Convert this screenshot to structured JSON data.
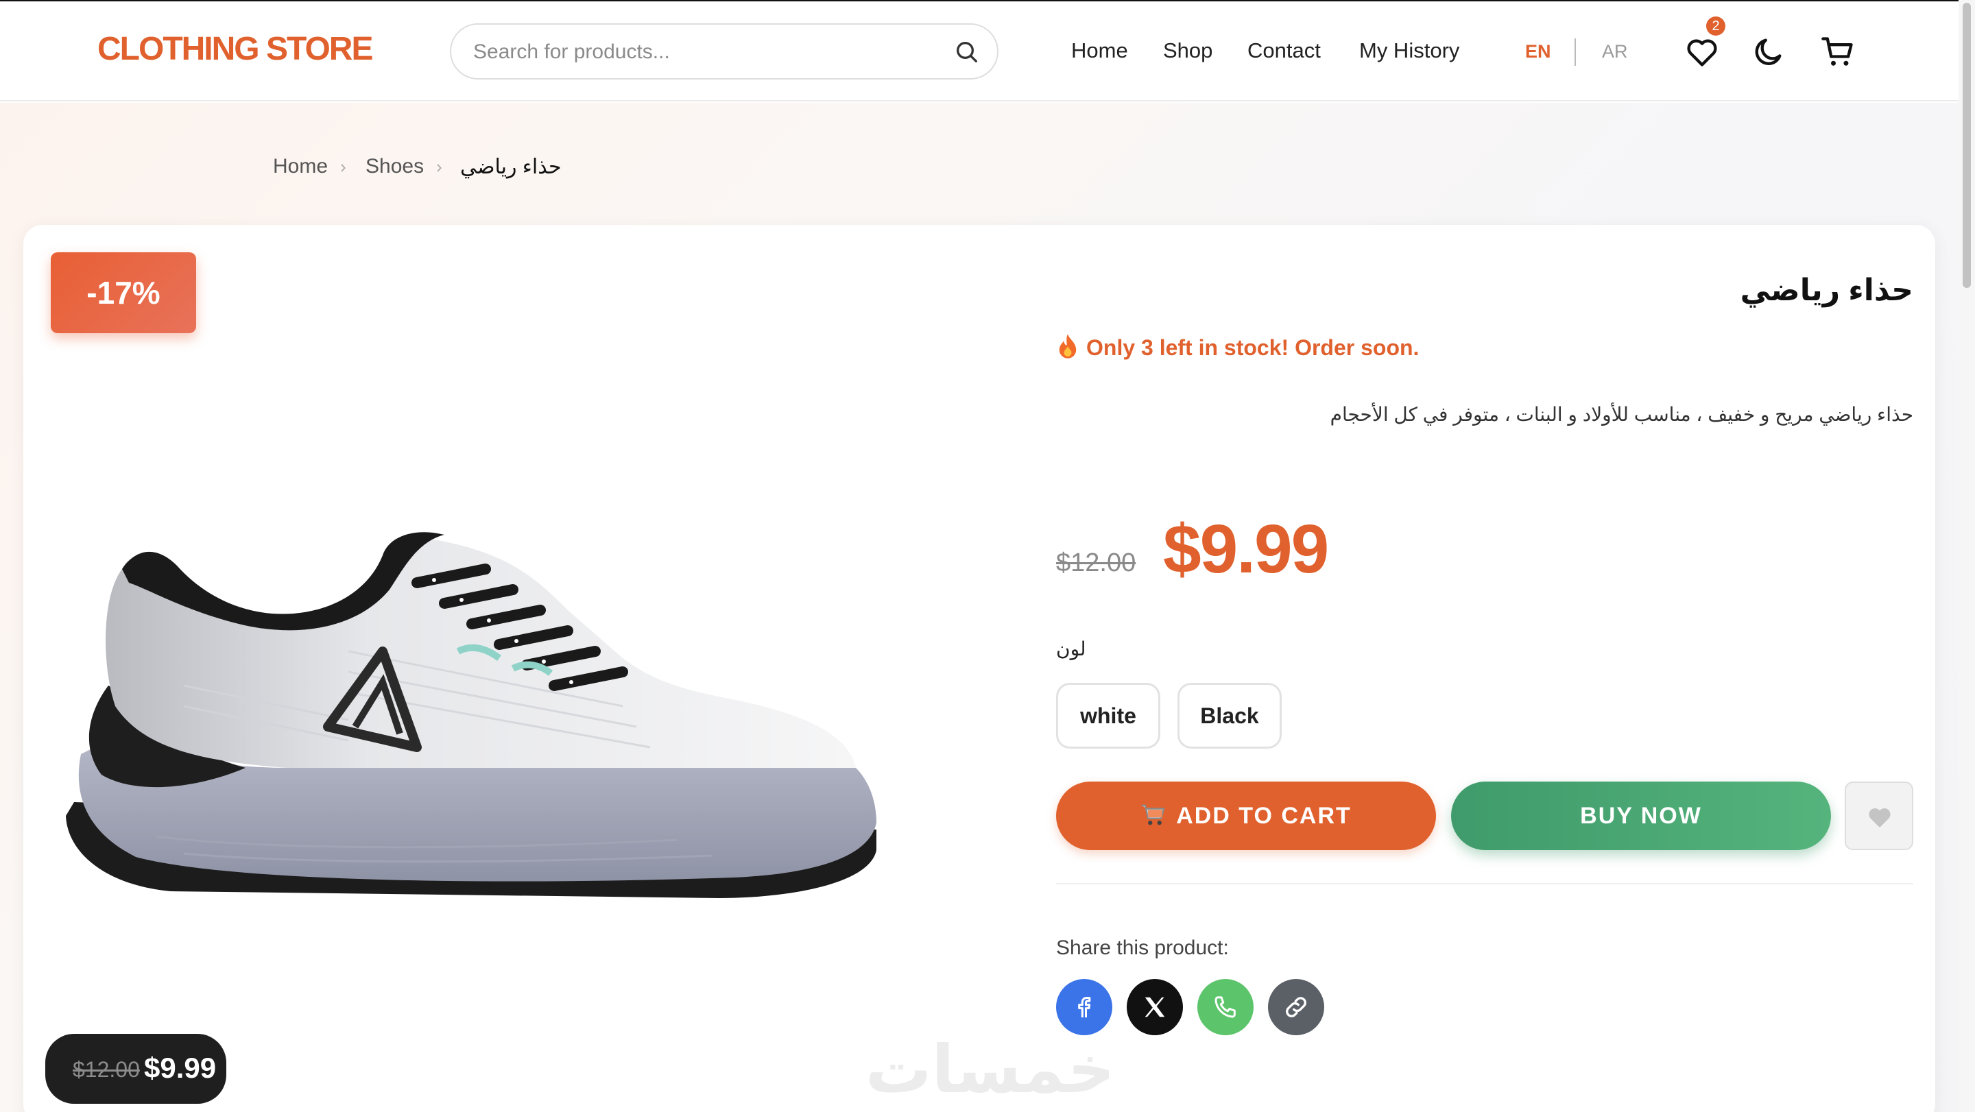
{
  "header": {
    "logo": "CLOTHING STORE",
    "search_placeholder": "Search for products...",
    "nav": [
      "Home",
      "Shop",
      "Contact",
      "My History"
    ],
    "lang_en": "EN",
    "lang_ar": "AR",
    "wishlist_count": "2"
  },
  "breadcrumb": {
    "home": "Home",
    "category": "Shoes",
    "current": "حذاء رياضي"
  },
  "product": {
    "discount": "-17%",
    "title": "حذاء رياضي",
    "stock": "Only 3 left in stock! Order soon.",
    "description": "حذاء رياضي مريح و خفيف ، مناسب للأولاد و البنات ، متوفر في كل الأحجام",
    "old_price": "$12.00",
    "price": "$9.99",
    "color_label": "لون",
    "colors": [
      "white",
      "Black"
    ],
    "add_to_cart": "ADD TO CART",
    "buy_now": "BUY NOW",
    "share_label": "Share this product:"
  },
  "sticky_price": {
    "old": "$12.00",
    "new": "$9.99"
  },
  "watermark": "خمسات",
  "colors": {
    "accent": "#e0612d",
    "buy": "#4aa873",
    "facebook": "#3b73e8",
    "x": "#111111",
    "whatsapp": "#5cc46a",
    "link": "#5b5f66"
  }
}
